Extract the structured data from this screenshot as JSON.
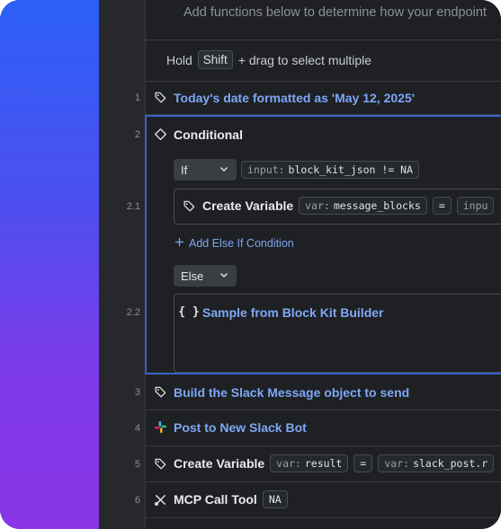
{
  "description": "Add functions below to determine how your endpoint",
  "hint": {
    "prefix": "Hold",
    "key": "Shift",
    "suffix": "+ drag to select multiple"
  },
  "lines": {
    "l1": "1",
    "l2": "2",
    "l21": "2.1",
    "l22": "2.2",
    "l3": "3",
    "l4": "4",
    "l5": "5",
    "l6": "6"
  },
  "steps": {
    "s1": {
      "label": "Today's date formatted as 'May 12, 2025'",
      "icon": "tag-icon"
    },
    "s2": {
      "label": "Conditional",
      "icon": "diamond-icon",
      "if_select": "If",
      "condition": {
        "key": "input:",
        "value": "block_kit_json != NA"
      },
      "create_var": {
        "label": "Create Variable",
        "var_key": "var:",
        "var_value": "message_blocks",
        "eq": "=",
        "rhs": "inpu"
      },
      "add_else_if": "Add Else If Condition",
      "else_select": "Else",
      "sample": "Sample from Block Kit Builder"
    },
    "s3": {
      "label": "Build the Slack Message object to send",
      "icon": "tag-icon"
    },
    "s4": {
      "label": "Post to New Slack Bot",
      "icon": "slack-icon"
    },
    "s5": {
      "label": "Create Variable",
      "var_key": "var:",
      "var_value": "result",
      "eq": "=",
      "rhs_key": "var:",
      "rhs_value": "slack_post.r"
    },
    "s6": {
      "label": "MCP Call Tool",
      "badge": "NA",
      "icon": "tools-icon"
    }
  },
  "colors": {
    "accent": "#3d63c9",
    "link": "#7ea7f4",
    "gradient_top": "#2c5ff6",
    "gradient_bottom": "#8a36e6"
  }
}
